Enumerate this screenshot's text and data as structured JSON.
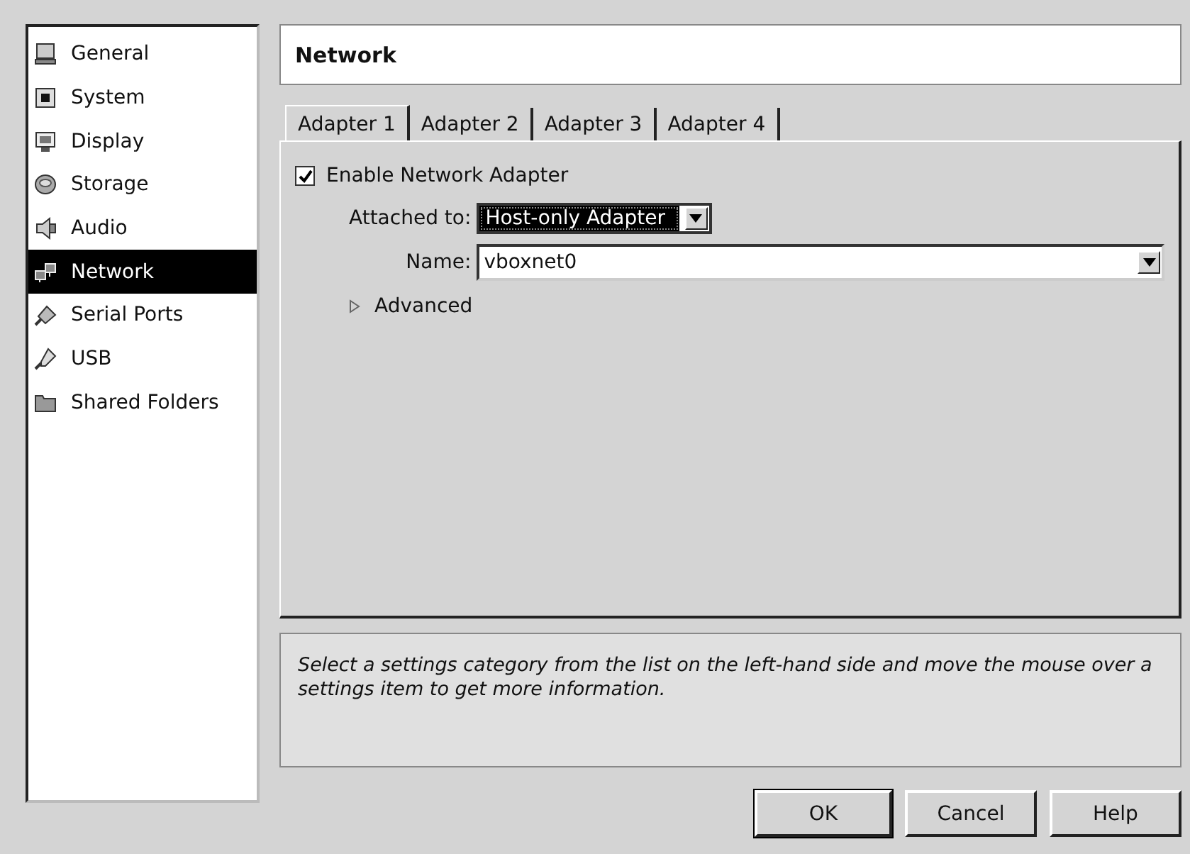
{
  "sidebar": {
    "items": [
      {
        "label": "General",
        "selected": false
      },
      {
        "label": "System",
        "selected": false
      },
      {
        "label": "Display",
        "selected": false
      },
      {
        "label": "Storage",
        "selected": false
      },
      {
        "label": "Audio",
        "selected": false
      },
      {
        "label": "Network",
        "selected": true
      },
      {
        "label": "Serial Ports",
        "selected": false
      },
      {
        "label": "USB",
        "selected": false
      },
      {
        "label": "Shared Folders",
        "selected": false
      }
    ]
  },
  "header": {
    "title": "Network"
  },
  "tabs": [
    {
      "label": "Adapter 1",
      "selected": true
    },
    {
      "label": "Adapter 2",
      "selected": false
    },
    {
      "label": "Adapter 3",
      "selected": false
    },
    {
      "label": "Adapter 4",
      "selected": false
    }
  ],
  "enable": {
    "label": "Enable Network Adapter",
    "checked": true
  },
  "attached": {
    "label": "Attached to:",
    "value": "Host-only Adapter"
  },
  "name": {
    "label": "Name:",
    "value": "vboxnet0"
  },
  "advanced": {
    "label": "Advanced",
    "expanded": false
  },
  "info": {
    "text": "Select a settings category from the list on the left-hand side and move the mouse over a settings item to get more information."
  },
  "buttons": [
    {
      "label": "OK",
      "kind": "default"
    },
    {
      "label": "Cancel",
      "kind": "normal"
    },
    {
      "label": "Help",
      "kind": "normal"
    }
  ]
}
